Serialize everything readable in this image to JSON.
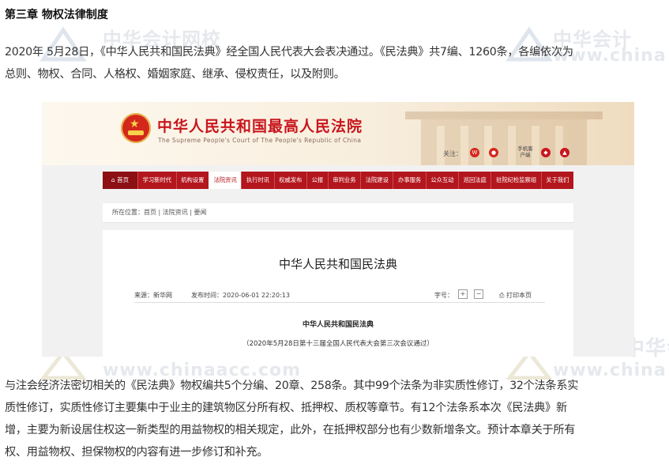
{
  "heading": "第三章 物权法律制度",
  "para1_line1": "2020年 5月28日，《中华人民共和国民法典》经全国人民代表大会表决通过。《民法典》共7编、1260条，各编依次为",
  "para1_line2": "总则、物权、合同、人格权、婚姻家庭、继承、侵权责任，以及附则。",
  "watermark": {
    "cn": "中华会计网校",
    "url": "www.chinaacc.com",
    "cn_short": "中华会计",
    "url_short": "www.china"
  },
  "court": {
    "title": "中华人民共和国最高人民法院",
    "subtitle": "The Supreme People's Court of The People's Republic of China",
    "follow_label": "关注：",
    "mobile_label": "手机客户端",
    "nav": [
      "首页",
      "学习新时代",
      "机构设置",
      "法院资讯",
      "执行时讯",
      "权威发布",
      "公报",
      "审判业务",
      "法院建设",
      "办事服务",
      "公众互动",
      "巡回法庭",
      "驻院纪检监察组",
      "关于我们"
    ],
    "breadcrumb": "所在位置：首页 | 法院资讯 | 要闻",
    "article_title": "中华人民共和国民法典",
    "source": "来源：新华网",
    "publish_time": "发布时间：2020-06-01 22:20:13",
    "font_size_label": "字号：",
    "font_plus": "+",
    "font_minus": "−",
    "print_label": "打印本页",
    "body_title": "中华人民共和国民法典",
    "body_note": "（2020年5月28日第十三届全国人民代表大会第三次会议通过）"
  },
  "para2_line1": "与注会经济法密切相关的《民法典》物权编共5个分编、20章、258条。其中99个法条为非实质性修订，32个法条系实",
  "para2_line2": "质性修订，实质性修订主要集中于业主的建筑物区分所有权、抵押权、质权等章节。有12个法条系本次《民法典》新",
  "para2_line3": "增，主要为新设居住权这一新类型的用益物权的相关规定，此外，在抵押权部分也有少数新增条文。预计本章关于所有",
  "para2_line4": "权、用益物权、担保物权的内容有进一步修订和补充。",
  "colors": {
    "court_red": "#b3161d",
    "court_title_red": "#c8161d"
  }
}
